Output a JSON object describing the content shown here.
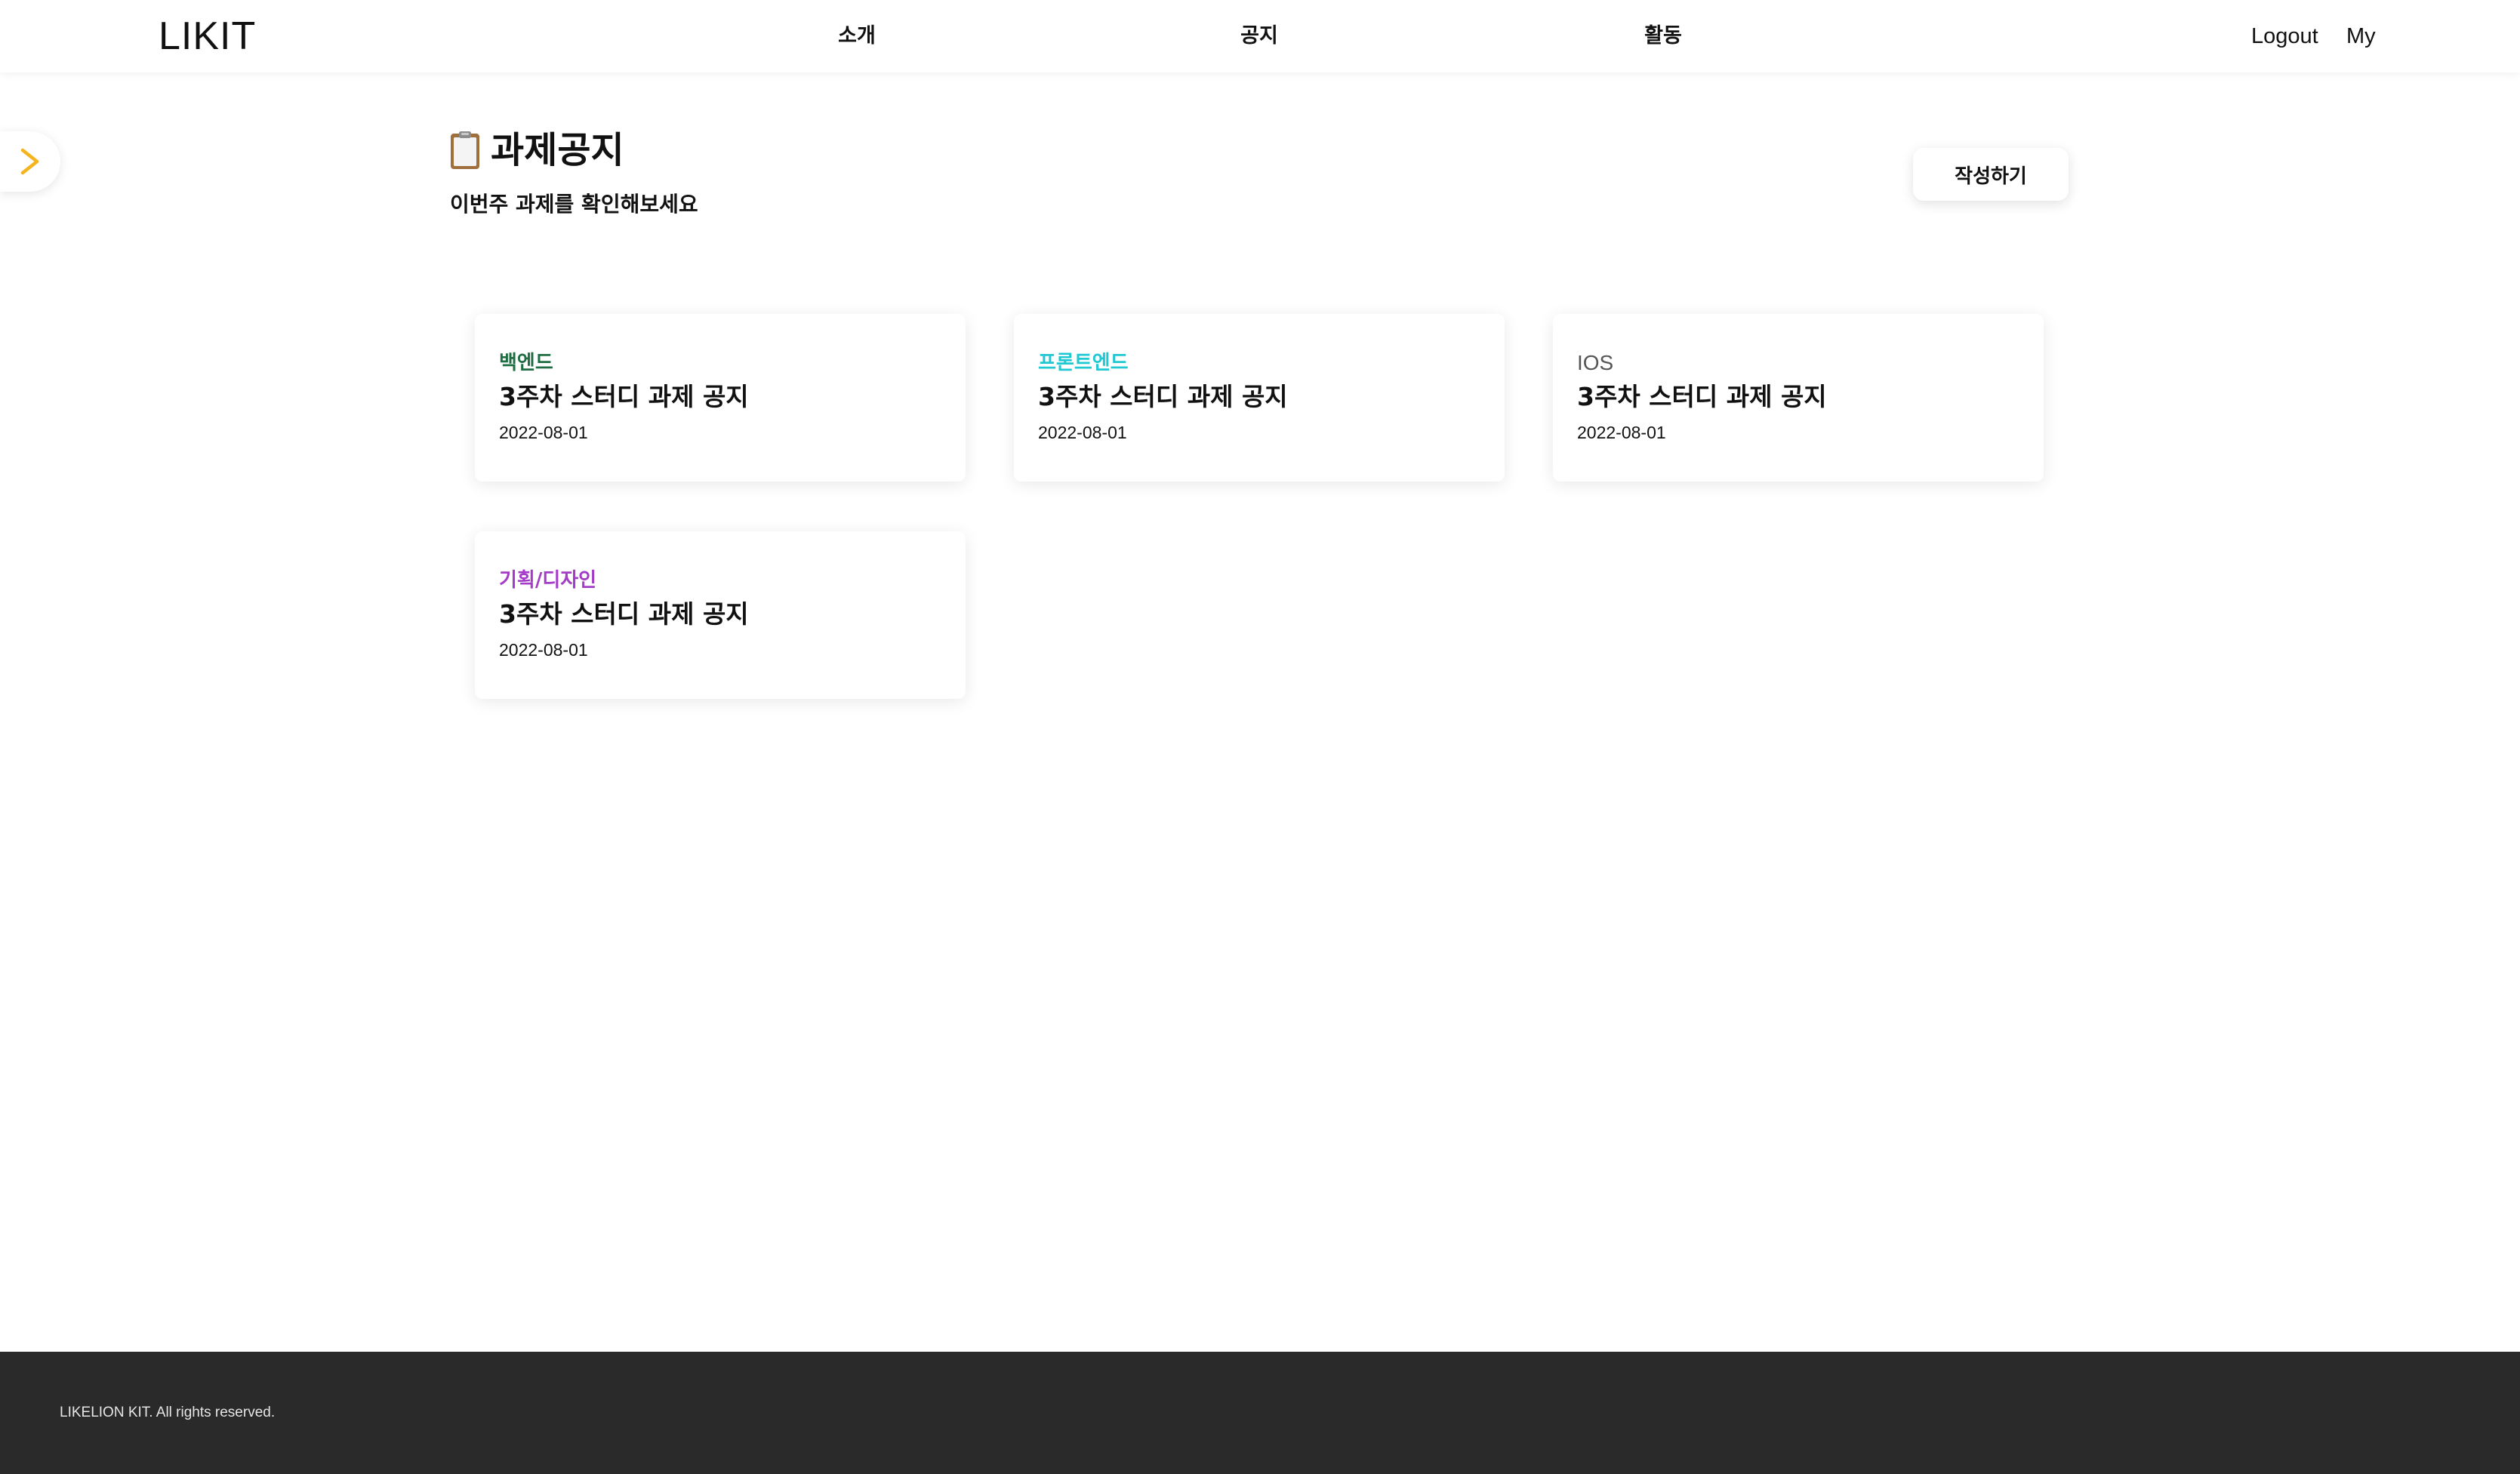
{
  "header": {
    "logo": "LIKIT",
    "nav": [
      {
        "label": "소개"
      },
      {
        "label": "공지"
      },
      {
        "label": "활동"
      }
    ],
    "logout_label": "Logout",
    "my_label": "My"
  },
  "sidebar_toggle": {
    "icon": "chevron-right-icon",
    "color": "#F5B41E"
  },
  "page": {
    "icon": "clipboard-icon",
    "title": "과제공지",
    "subtitle": "이번주 과제를 확인해보세요",
    "write_button_label": "작성하기"
  },
  "cards": [
    {
      "category": "백엔드",
      "category_color": "#1F6E43",
      "title": "3주차 스터디 과제 공지",
      "date": "2022-08-01"
    },
    {
      "category": "프론트엔드",
      "category_color": "#1FC8D2",
      "title": "3주차 스터디 과제 공지",
      "date": "2022-08-01"
    },
    {
      "category": "IOS",
      "category_color": "#555555",
      "title": "3주차 스터디 과제 공지",
      "date": "2022-08-01"
    },
    {
      "category": "기획/디자인",
      "category_color": "#A43CC8",
      "title": "3주차 스터디 과제 공지",
      "date": "2022-08-01"
    }
  ],
  "footer": {
    "text": "LIKELION KIT.  All rights reserved."
  }
}
